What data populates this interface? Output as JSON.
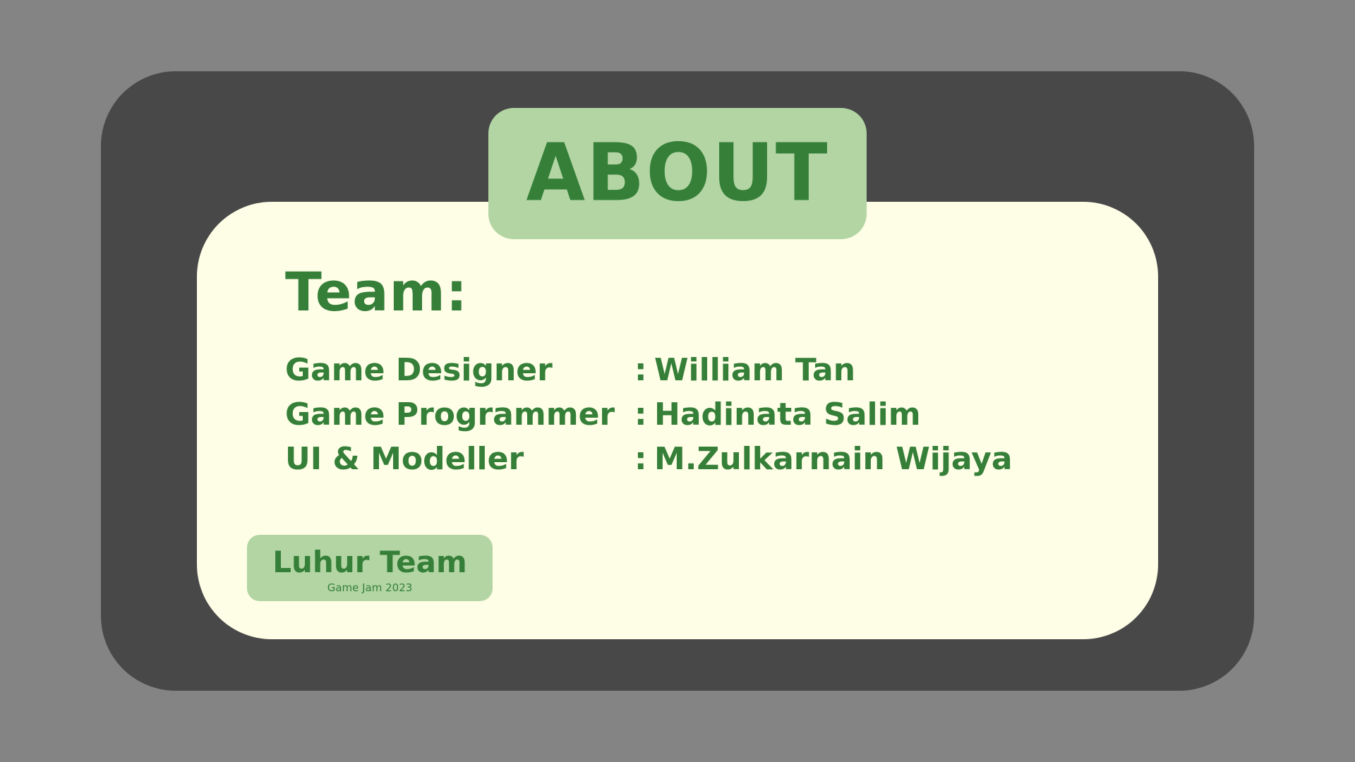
{
  "about": {
    "title": "ABOUT"
  },
  "team": {
    "heading": "Team:",
    "separator": ":",
    "members": [
      {
        "role": "Game Designer",
        "name": "William Tan"
      },
      {
        "role": "Game Programmer",
        "name": "Hadinata Salim"
      },
      {
        "role": "UI & Modeller",
        "name": "M.Zulkarnain Wijaya"
      }
    ]
  },
  "badge": {
    "title": "Luhur Team",
    "subtitle": "Game Jam 2023"
  },
  "colors": {
    "background": "#848484",
    "panel": "#484848",
    "card": "#fefde6",
    "accent_light": "#b2d5a3",
    "accent_dark": "#357f39"
  }
}
